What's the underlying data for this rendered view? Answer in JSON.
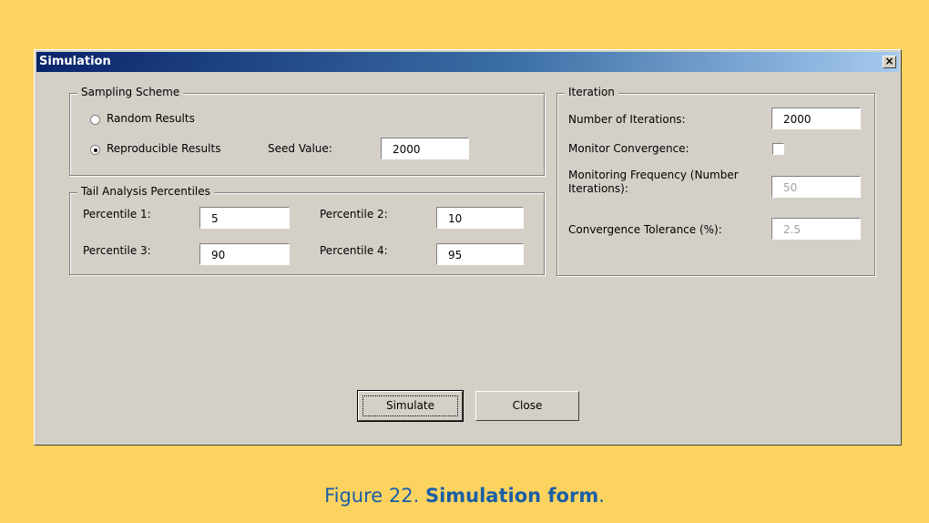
{
  "window": {
    "title": "Simulation",
    "close_glyph": "×"
  },
  "sampling": {
    "legend": "Sampling Scheme",
    "random_label": "Random Results",
    "reproducible_label": "Reproducible Results",
    "selected": "Reproducible Results",
    "seed_label": "Seed Value:",
    "seed_value": "2000"
  },
  "tail": {
    "legend": "Tail Analysis Percentiles",
    "p1_label": "Percentile 1:",
    "p1_value": "5",
    "p2_label": "Percentile 2:",
    "p2_value": "10",
    "p3_label": "Percentile 3:",
    "p3_value": "90",
    "p4_label": "Percentile 4:",
    "p4_value": "95"
  },
  "iteration": {
    "legend": "Iteration",
    "num_label": "Number of Iterations:",
    "num_value": "2000",
    "monitor_label": "Monitor Convergence:",
    "monitor_checked": false,
    "freq_label": "Monitoring Frequency (Number Iterations):",
    "freq_value": "50",
    "tol_label": "Convergence Tolerance (%):",
    "tol_value": "2.5"
  },
  "buttons": {
    "simulate": "Simulate",
    "close": "Close"
  },
  "caption": {
    "prefix": "Figure 22. ",
    "bold": "Simulation form",
    "suffix": "."
  }
}
